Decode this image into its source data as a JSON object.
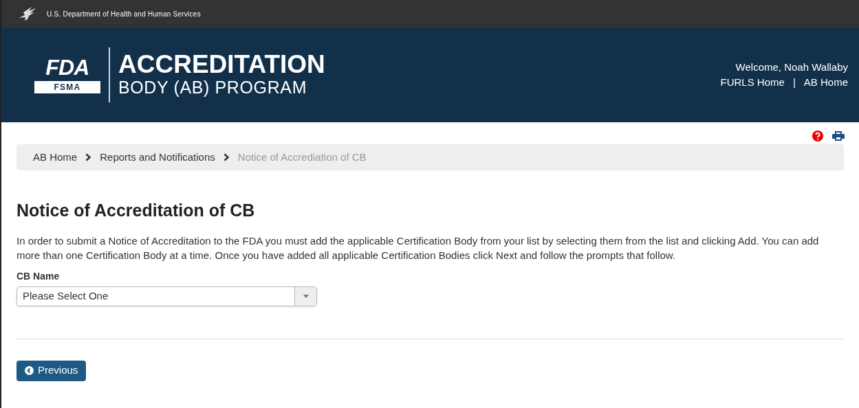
{
  "agency_bar": {
    "text": "U.S. Department of Health and Human Services"
  },
  "header": {
    "logo": {
      "top": "FDA",
      "bottom": "FSMA"
    },
    "title": "ACCREDITATION",
    "subtitle": "BODY (AB) PROGRAM",
    "welcome": "Welcome, Noah Wallaby",
    "links": [
      "FURLS Home",
      "AB Home"
    ],
    "separator": "|"
  },
  "breadcrumb": [
    {
      "label": "AB Home",
      "current": false
    },
    {
      "label": "Reports and Notifications",
      "current": false
    },
    {
      "label": "Notice of Accrediation of CB",
      "current": true
    }
  ],
  "page_title": "Notice of Accreditation of CB",
  "instructions": "In order to submit a Notice of Accreditation to the FDA you must add the applicable Certification Body from your list by selecting them from the list and clicking Add. You can add more than one Certification Body at a time. Once you have added all applicable Certification Bodies click Next and follow the prompts that follow.",
  "cb_name": {
    "label": "CB Name",
    "value": "Please Select One"
  },
  "buttons": [
    {
      "label": "Previous"
    }
  ]
}
